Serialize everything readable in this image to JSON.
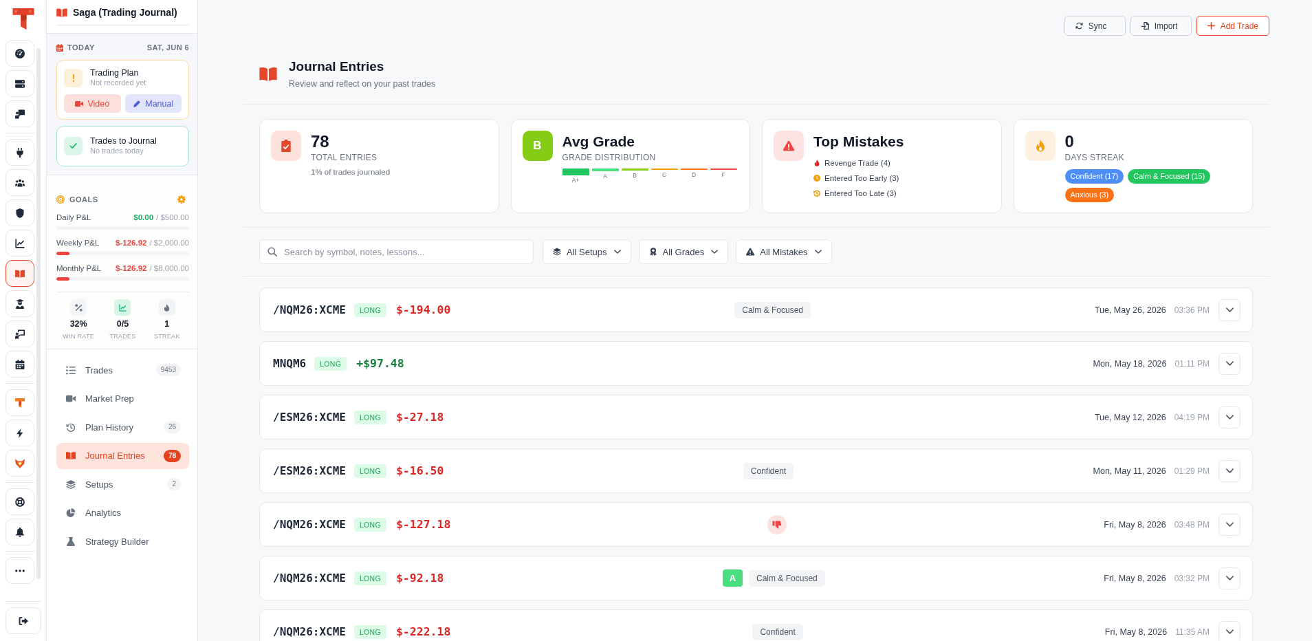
{
  "rail": {
    "groups": [
      {
        "items": [
          {
            "selected": false
          },
          {
            "selected": false
          },
          {
            "selected": false
          }
        ]
      },
      {
        "items": [
          {
            "selected": false
          },
          {
            "selected": false
          },
          {
            "selected": false
          },
          {
            "selected": false
          },
          {
            "selected": true
          },
          {
            "selected": false
          },
          {
            "selected": false
          },
          {
            "selected": false
          }
        ]
      },
      {
        "items": [
          {
            "selected": false
          },
          {
            "selected": false
          },
          {
            "selected": false
          }
        ]
      },
      {
        "items": [
          {
            "selected": false
          },
          {
            "selected": false
          }
        ]
      },
      {
        "items": [
          {
            "selected": false
          }
        ]
      }
    ]
  },
  "sidebar": {
    "title": "Saga (Trading Journal)",
    "today": {
      "label": "TODAY",
      "date": "SAT, JUN 6",
      "plan": {
        "title": "Trading Plan",
        "status": "Not recorded yet",
        "buttons": [
          {
            "label": "Video",
            "kind": "video"
          },
          {
            "label": "Manual",
            "kind": "manual"
          }
        ]
      },
      "journal_task": {
        "title": "Trades to Journal",
        "status": "No trades today"
      }
    },
    "goals": {
      "label": "GOALS",
      "items": [
        {
          "name": "Daily P&L",
          "value": "$0.00",
          "target": "/ $500.00",
          "negative": false
        },
        {
          "name": "Weekly P&L",
          "value": "$-126.92",
          "target": "/ $2,000.00",
          "negative": true,
          "level": 0.1
        },
        {
          "name": "Monthly P&L",
          "value": "$-126.92",
          "target": "/ $8,000.00",
          "negative": true,
          "level": 0.1
        }
      ],
      "stats": [
        {
          "value": "32%",
          "label": "WIN RATE",
          "highlighted": false
        },
        {
          "value": "0/5",
          "label": "TRADES",
          "highlighted": true
        },
        {
          "value": "1",
          "label": "STREAK",
          "highlighted": false
        }
      ]
    },
    "nav": [
      {
        "label": "Trades",
        "count": "9453",
        "selected": false
      },
      {
        "label": "Market Prep",
        "selected": false
      },
      {
        "label": "Plan History",
        "count": "26",
        "selected": false
      },
      {
        "label": "Journal Entries",
        "count": "78",
        "selected": true
      },
      {
        "label": "Setups",
        "count": "2",
        "selected": false
      },
      {
        "label": "Analytics",
        "selected": false
      },
      {
        "label": "Strategy Builder",
        "selected": false
      }
    ]
  },
  "toolbar": {
    "buttons": [
      {
        "label": "Sync",
        "kind": "sync"
      },
      {
        "label": "Import",
        "kind": "import"
      },
      {
        "label": "Add Trade",
        "kind": "add"
      }
    ]
  },
  "header": {
    "title": "Journal Entries",
    "subtitle": "Review and reflect on your past trades"
  },
  "stats": [
    {
      "kind": "entries",
      "value": "78",
      "label": "TOTAL ENTRIES",
      "note": "1% of trades journaled"
    },
    {
      "kind": "grade",
      "badge": "B",
      "value": "Avg Grade",
      "label": "GRADE DISTRIBUTION",
      "distribution": [
        {
          "grade": "A+",
          "color": "#22c55e"
        },
        {
          "grade": "A",
          "color": "#4ade80"
        },
        {
          "grade": "B",
          "color": "#84cc16"
        },
        {
          "grade": "C",
          "color": "#f59e0b"
        },
        {
          "grade": "D",
          "color": "#f97316"
        },
        {
          "grade": "F",
          "color": "#ef4444"
        }
      ]
    },
    {
      "kind": "mistakes",
      "value": "Top Mistakes",
      "mistakes": [
        {
          "label": "Revenge Trade (4)",
          "color": "#dc2626"
        },
        {
          "label": "Entered Too Early (3)",
          "color": "#f59e0b"
        },
        {
          "label": "Entered Too Late (3)",
          "color": "#f59e0b"
        }
      ]
    },
    {
      "kind": "streak",
      "value": "0",
      "label": "DAYS STREAK",
      "moods": [
        {
          "label": "Confident (17)",
          "color": "#4f8ef7"
        },
        {
          "label": "Calm & Focused (15)",
          "color": "#22c55e"
        },
        {
          "label": "Anxious (3)",
          "color": "#f97316"
        }
      ]
    }
  ],
  "filters": {
    "search": {
      "placeholder": "Search by symbol, notes, lessons..."
    },
    "dropdowns": [
      {
        "label": "All Setups"
      },
      {
        "label": "All Grades"
      },
      {
        "label": "All Mistakes"
      }
    ]
  },
  "entries": [
    {
      "symbol": "/NQM26:XCME",
      "side": "LONG",
      "pnl": "$-194.00",
      "loss": true,
      "flagged": false,
      "tags": [
        "Calm & Focused"
      ],
      "date": "Tue, May 26, 2026",
      "time": "03:36 PM"
    },
    {
      "symbol": "MNQM6",
      "side": "LONG",
      "pnl": "+$97.48",
      "loss": false,
      "flagged": false,
      "date": "Mon, May 18, 2026",
      "time": "01:11 PM"
    },
    {
      "symbol": "/ESM26:XCME",
      "side": "LONG",
      "pnl": "$-27.18",
      "loss": true,
      "flagged": false,
      "date": "Tue, May 12, 2026",
      "time": "04:19 PM"
    },
    {
      "symbol": "/ESM26:XCME",
      "side": "LONG",
      "pnl": "$-16.50",
      "loss": true,
      "flagged": false,
      "tags": [
        "Confident"
      ],
      "date": "Mon, May 11, 2026",
      "time": "01:29 PM"
    },
    {
      "symbol": "/NQM26:XCME",
      "side": "LONG",
      "pnl": "$-127.18",
      "loss": true,
      "flagged": true,
      "date": "Fri, May 8, 2026",
      "time": "03:48 PM"
    },
    {
      "symbol": "/NQM26:XCME",
      "side": "LONG",
      "pnl": "$-92.18",
      "loss": true,
      "flagged": false,
      "grade": "A",
      "tags": [
        "Calm & Focused"
      ],
      "date": "Fri, May 8, 2026",
      "time": "03:32 PM"
    },
    {
      "symbol": "/NQM26:XCME",
      "side": "LONG",
      "pnl": "$-222.18",
      "loss": true,
      "flagged": false,
      "tags": [
        "Confident"
      ],
      "date": "Fri, May 8, 2026",
      "time": "11:35 AM"
    }
  ]
}
